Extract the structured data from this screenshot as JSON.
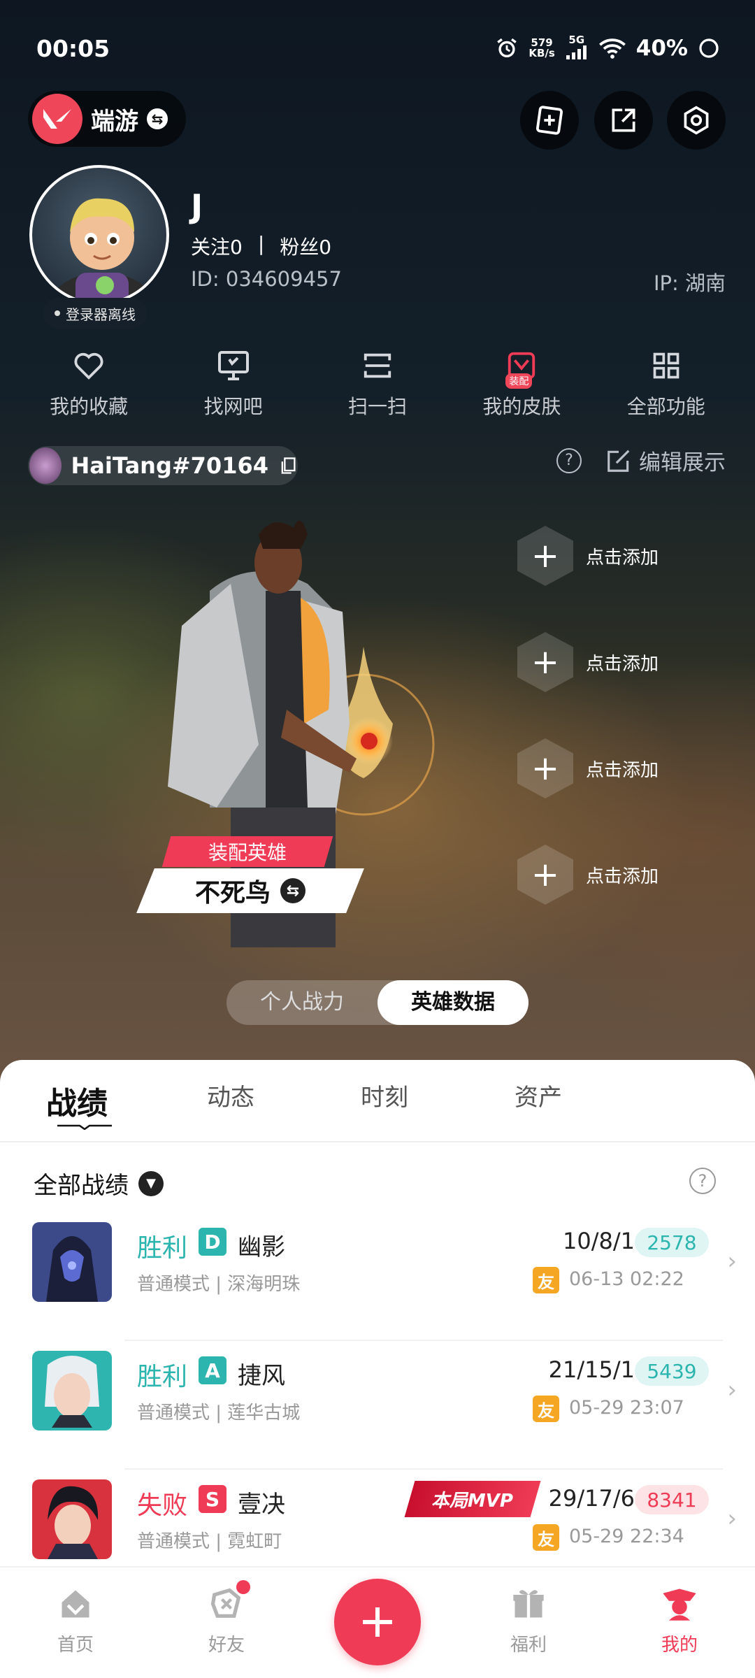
{
  "status_bar": {
    "time": "00:05",
    "net_speed": "579",
    "net_unit": "KB/s",
    "network": "5G",
    "battery": "40%"
  },
  "header": {
    "brand": "端游",
    "icons": [
      "add-card-icon",
      "share-icon",
      "settings-icon"
    ]
  },
  "profile": {
    "name": "J",
    "follow_label": "关注",
    "follow_count": "0",
    "fans_label": "粉丝",
    "fans_count": "0",
    "id_text": "ID: 034609457",
    "ip_text": "IP: 湖南",
    "launcher_status": "登录器离线"
  },
  "quick_menu": [
    {
      "label": "我的收藏",
      "icon": "heart-icon"
    },
    {
      "label": "找网吧",
      "icon": "monitor-icon"
    },
    {
      "label": "扫一扫",
      "icon": "scan-icon"
    },
    {
      "label": "我的皮肤",
      "icon": "skin-icon",
      "tag": "装配"
    },
    {
      "label": "全部功能",
      "icon": "grid-icon"
    }
  ],
  "riot_id": "HaiTang#70164",
  "edit_label": "编辑展示",
  "hero_showcase": {
    "equip_label": "装配英雄",
    "hero_name": "不死鸟",
    "slots": [
      "点击添加",
      "点击添加",
      "点击添加",
      "点击添加"
    ]
  },
  "toggle": {
    "left": "个人战力",
    "right": "英雄数据",
    "active": "right"
  },
  "tabs": [
    "战绩",
    "动态",
    "时刻",
    "资产"
  ],
  "filter_label": "全部战绩",
  "matches": [
    {
      "result": "胜利",
      "grade": "D",
      "hero": "幽影",
      "mode": "普通模式 | 深海明珠",
      "kda": "10/8/1",
      "score": "2578",
      "friend_tag": "友",
      "time": "06-13 02:22"
    },
    {
      "result": "胜利",
      "grade": "A",
      "hero": "捷风",
      "mode": "普通模式 | 莲华古城",
      "kda": "21/15/1",
      "score": "5439",
      "friend_tag": "友",
      "time": "05-29 23:07"
    },
    {
      "result": "失败",
      "grade": "S",
      "hero": "壹决",
      "mode": "普通模式 | 霓虹町",
      "kda": "29/17/6",
      "score": "8341",
      "friend_tag": "友",
      "time": "05-29 22:34",
      "badge": "本局MVP"
    }
  ],
  "colors": {
    "accent": "#ef3b55",
    "win": "#2bb5ae",
    "grade_d": "#2bb5ae",
    "grade_a": "#2bb5ae",
    "grade_s": "#ef3b55",
    "friend": "#f5a623"
  },
  "bottom_nav": [
    {
      "label": "首页",
      "icon": "home-icon"
    },
    {
      "label": "好友",
      "icon": "friends-icon"
    },
    {
      "label": "福利",
      "icon": "gift-icon"
    },
    {
      "label": "我的",
      "icon": "profile-icon"
    }
  ]
}
